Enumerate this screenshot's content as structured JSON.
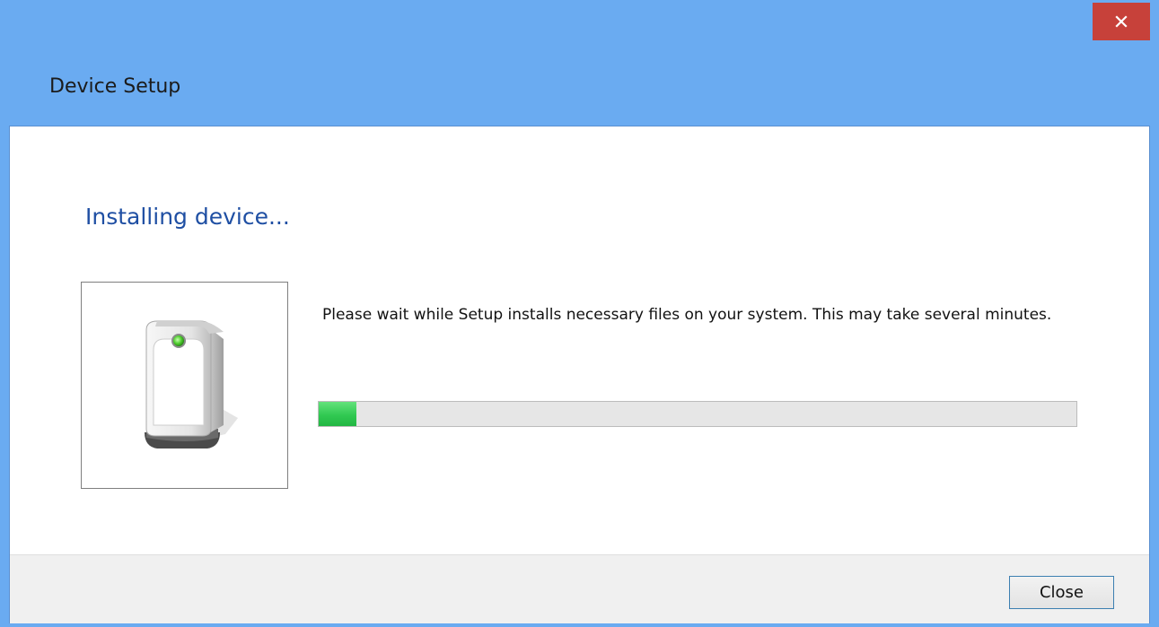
{
  "window": {
    "title": "Device Setup",
    "close_icon": "close-icon"
  },
  "main": {
    "heading": "Installing device...",
    "message": "Please wait while Setup installs necessary files on your system. This may take several minutes.",
    "device_icon": "device-icon",
    "progress_percent": 5
  },
  "footer": {
    "close_label": "Close"
  },
  "colors": {
    "title_bar": "#6aabf1",
    "close_button_bg": "#c7413a",
    "heading": "#1f4fa3",
    "progress_fill": "#31c952"
  }
}
